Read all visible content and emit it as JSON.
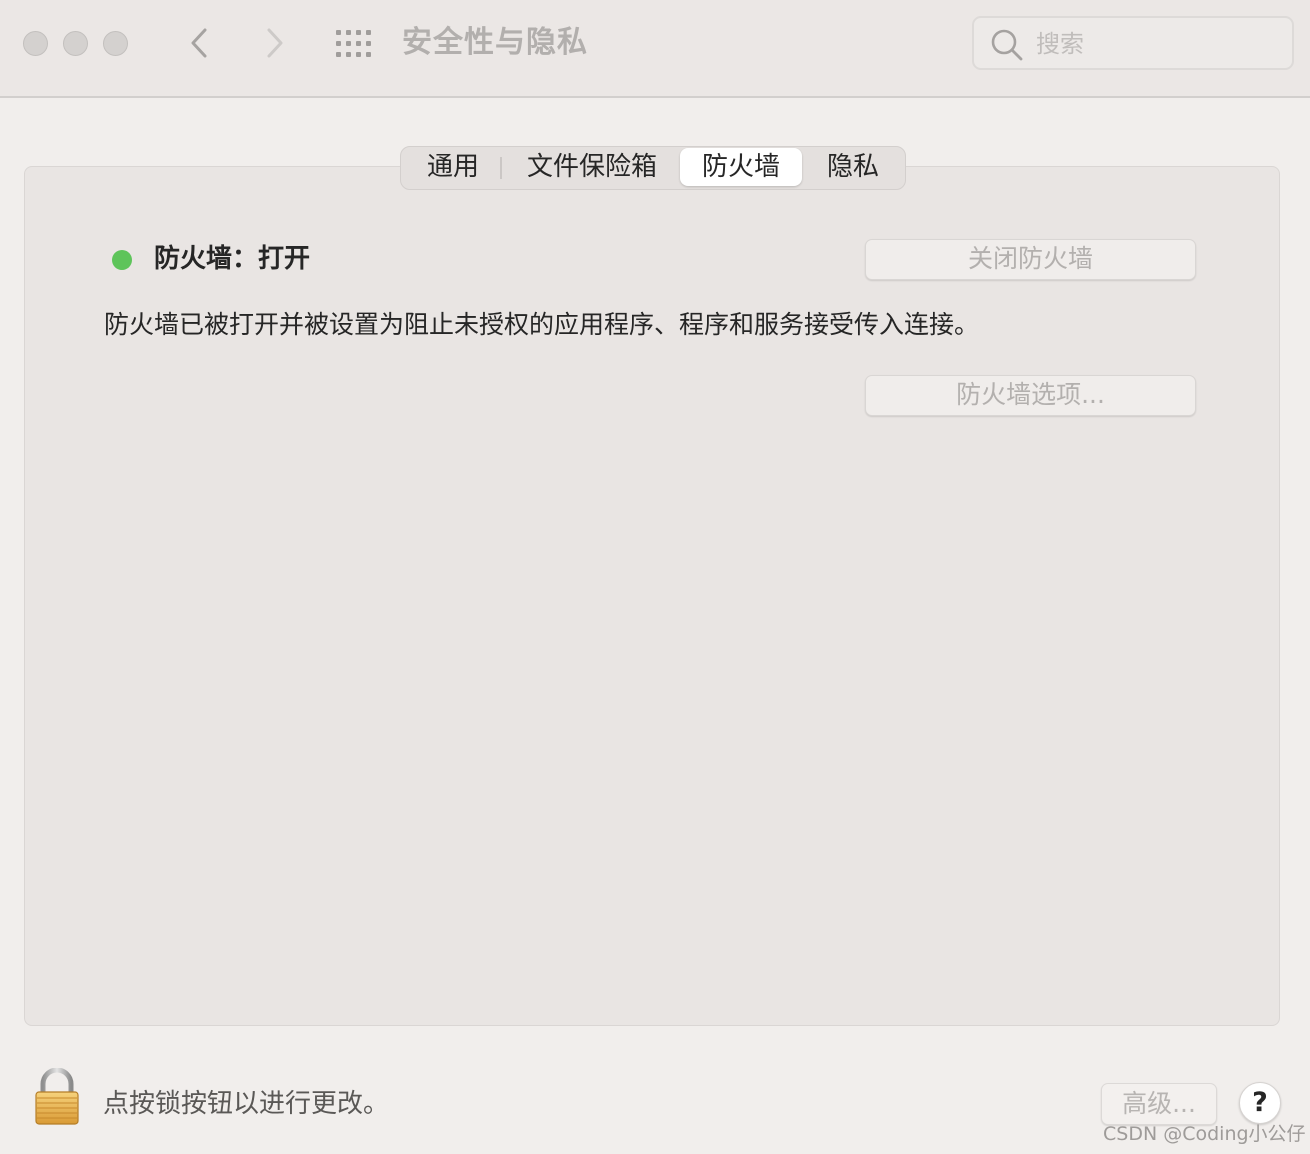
{
  "window": {
    "title": "安全性与隐私",
    "traffic_lights": [
      "close",
      "minimize",
      "zoom"
    ]
  },
  "toolbar": {
    "back_icon": "chevron-left-icon",
    "forward_icon": "chevron-right-icon",
    "show_all_icon": "grid-icon",
    "search": {
      "placeholder": "搜索",
      "value": ""
    }
  },
  "tabs": [
    {
      "label": "通用",
      "selected": false
    },
    {
      "label": "文件保险箱",
      "selected": false
    },
    {
      "label": "防火墙",
      "selected": true
    },
    {
      "label": "隐私",
      "selected": false
    }
  ],
  "firewall": {
    "status_label": "防火墙：打开",
    "status_color": "#5ec45a",
    "turn_off_button": "关闭防火墙",
    "description": "防火墙已被打开并被设置为阻止未授权的应用程序、程序和服务接受传入连接。",
    "options_button": "防火墙选项..."
  },
  "footer": {
    "lock_text": "点按锁按钮以进行更改。",
    "advanced_button": "高级...",
    "help_button": "?"
  },
  "watermark": "CSDN @Coding小公仔"
}
